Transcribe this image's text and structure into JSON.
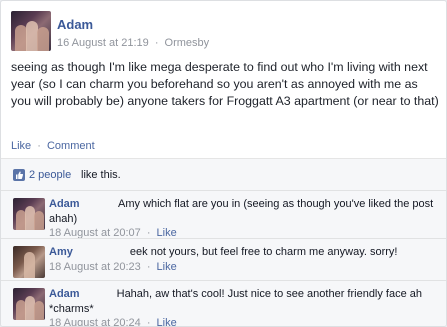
{
  "post": {
    "author": "Adam",
    "date": "16 August at 21:19",
    "separator": "·",
    "location": "Ormesby",
    "text": "seeing as though I'm like mega desperate to find out who I'm living with next year (so I can charm you beforehand so you aren't as annoyed with me as you will probably be) anyone takers for Froggatt A3 apartment (or near to that)",
    "actions": {
      "like": "Like",
      "dot": "·",
      "comment": "Comment"
    }
  },
  "likes": {
    "count_label": "2 people",
    "suffix": "like this."
  },
  "comments": [
    {
      "author": "Adam",
      "text": "Amy which flat are you in (seeing as though you've liked the post ahah)",
      "time": "18 August at 20:07",
      "dot": "·",
      "like": "Like"
    },
    {
      "author": "Amy",
      "text": "eek not yours, but feel free to charm me anyway. sorry!",
      "time": "18 August at 20:23",
      "dot": "·",
      "like": "Like"
    },
    {
      "author": "Adam",
      "text": "Hahah, aw that's cool! Just nice to see another friendly face ah *charms*",
      "time": "18 August at 20:24",
      "dot": "·",
      "like": "Like"
    }
  ],
  "icons": {
    "like": "thumbs-up-icon"
  },
  "colors": {
    "link": "#3b5998",
    "meta": "#90949c",
    "feedback_bg": "#f6f7f9"
  }
}
